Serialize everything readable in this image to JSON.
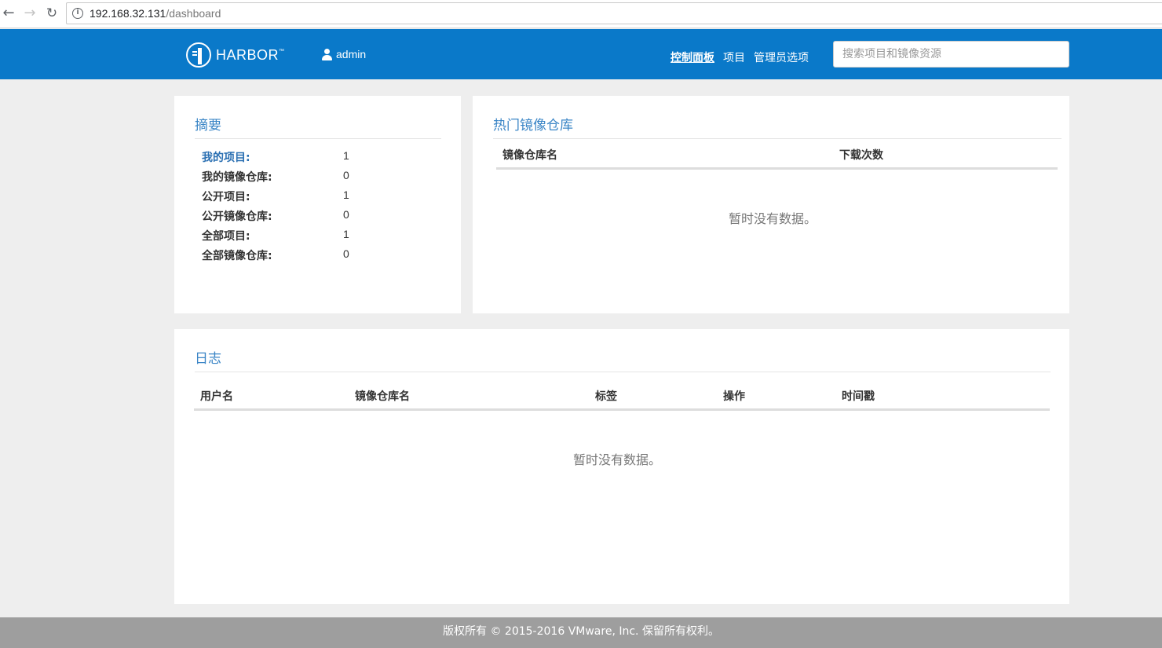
{
  "browser": {
    "url_host": "192.168.32.131",
    "url_path": "/dashboard"
  },
  "header": {
    "logo_text": "HARBOR",
    "logo_tm": "™",
    "username": "admin",
    "nav": [
      "控制面板",
      "项目",
      "管理员选项"
    ],
    "search_placeholder": "搜索项目和镜像资源"
  },
  "summary": {
    "title": "摘要",
    "rows": [
      {
        "label": "我的项目:",
        "value": "1"
      },
      {
        "label": "我的镜像仓库:",
        "value": "0"
      },
      {
        "label": "公开项目:",
        "value": "1"
      },
      {
        "label": "公开镜像仓库:",
        "value": "0"
      },
      {
        "label": "全部项目:",
        "value": "1"
      },
      {
        "label": "全部镜像仓库:",
        "value": "0"
      }
    ]
  },
  "top_repos": {
    "title": "热门镜像仓库",
    "columns": [
      "镜像仓库名",
      "下载次数"
    ],
    "empty_text": "暂时没有数据。"
  },
  "logs": {
    "title": "日志",
    "columns": [
      "用户名",
      "镜像仓库名",
      "标签",
      "操作",
      "时间戳"
    ],
    "empty_text": "暂时没有数据。"
  },
  "footer": {
    "text": "版权所有 © 2015-2016 VMware, Inc. 保留所有权利。"
  }
}
